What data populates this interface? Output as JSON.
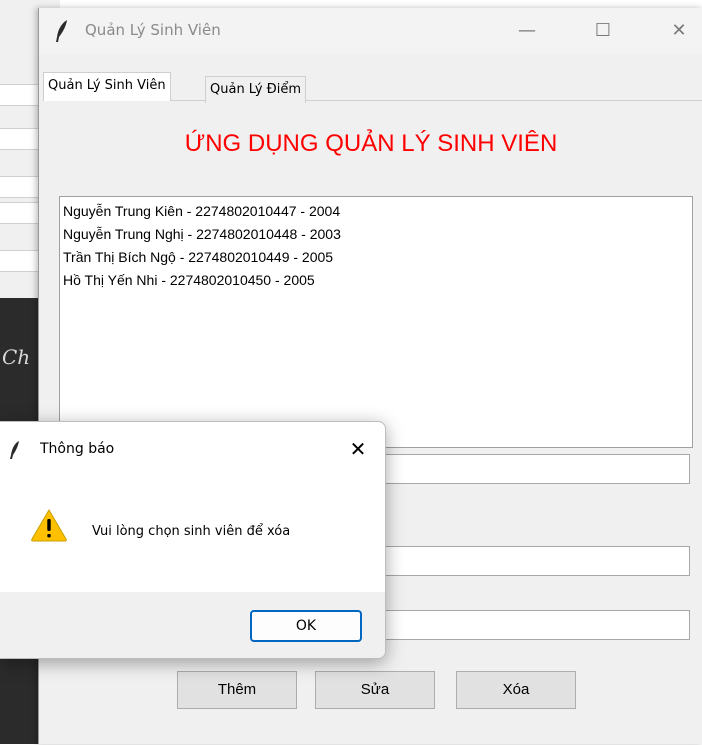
{
  "background_app": {
    "partial_text": "Ch"
  },
  "main_window": {
    "title": "Quản Lý Sinh Viên",
    "controls": {
      "minimize": "—",
      "maximize": "☐",
      "close": "✕"
    },
    "tabs": [
      {
        "label": "Quản Lý Sinh Viên",
        "active": true
      },
      {
        "label": "Quản Lý Điểm",
        "active": false
      }
    ],
    "heading": "ỨNG DỤNG QUẢN LÝ SINH VIÊN",
    "students": [
      "Nguyễn Trung Kiên - 2274802010447 - 2004",
      "Nguyễn Trung Nghị  - 2274802010448 - 2003",
      "Trần Thị Bích Ngộ  - 2274802010449 - 2005",
      "Hồ Thị Yến Nhi - 2274802010450 - 2005"
    ],
    "fields": [
      "",
      "",
      ""
    ],
    "buttons": {
      "add": "Thêm",
      "edit": "Sửa",
      "delete": "Xóa"
    }
  },
  "dialog": {
    "title": "Thông báo",
    "close": "✕",
    "message": "Vui lòng chọn sinh viên để xóa",
    "ok": "OK",
    "icon": "warning-icon"
  },
  "colors": {
    "heading": "#ff0000",
    "ok_border": "#0067c0",
    "warning_fill": "#ffc000"
  }
}
